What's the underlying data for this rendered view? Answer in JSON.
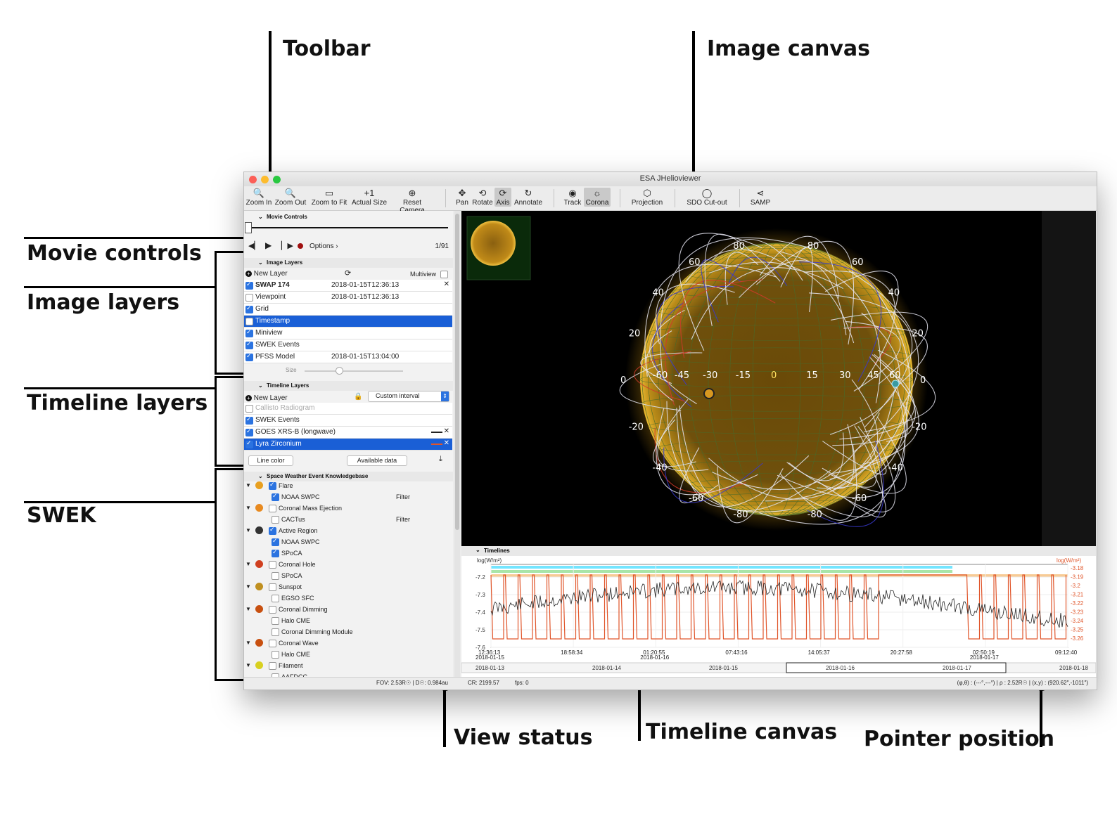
{
  "callouts": {
    "toolbar": "Toolbar",
    "image_canvas": "Image  canvas",
    "movie_controls": "Movie controls",
    "image_layers": "Image layers",
    "timeline_layers": "Timeline layers",
    "swek": "SWEK",
    "view_status": "View status",
    "timeline_canvas": "Timeline canvas",
    "pointer_position": "Pointer position"
  },
  "window": {
    "title": "ESA JHelioviewer"
  },
  "toolbar": {
    "buttons": [
      {
        "label": "Zoom In",
        "icon": "zoom-in-icon",
        "glyph": "🔍"
      },
      {
        "label": "Zoom Out",
        "icon": "zoom-out-icon",
        "glyph": "🔍"
      },
      {
        "label": "Zoom to Fit",
        "icon": "zoom-fit-icon",
        "glyph": "▭"
      },
      {
        "label": "Actual Size",
        "icon": "actual-size-icon",
        "glyph": "+1"
      },
      {
        "label": "Reset Camera",
        "icon": "reset-camera-icon",
        "glyph": "⊕"
      },
      {
        "label": "Pan",
        "icon": "pan-icon",
        "glyph": "✥"
      },
      {
        "label": "Rotate",
        "icon": "rotate-icon",
        "glyph": "⟲"
      },
      {
        "label": "Axis",
        "icon": "axis-icon",
        "glyph": "⟳"
      },
      {
        "label": "Annotate",
        "icon": "annotate-icon",
        "glyph": "↻"
      },
      {
        "label": "Track",
        "icon": "track-icon",
        "glyph": "◉"
      },
      {
        "label": "Corona",
        "icon": "corona-icon",
        "glyph": "☼"
      },
      {
        "label": "Projection",
        "icon": "projection-icon",
        "glyph": "⬡"
      },
      {
        "label": "SDO Cut-out",
        "icon": "sdo-cutout-icon",
        "glyph": "◯"
      },
      {
        "label": "SAMP",
        "icon": "share-icon",
        "glyph": "⋖"
      }
    ]
  },
  "movie_controls": {
    "header": "Movie Controls",
    "options_label": "Options ›",
    "frame": "1/91"
  },
  "image_layers": {
    "header": "Image Layers",
    "new_layer": "New Layer",
    "multiview": "Multiview",
    "layers": [
      {
        "name": "SWAP 174",
        "time": "2018-01-15T12:36:13",
        "checked": true,
        "selected": false,
        "bold": true
      },
      {
        "name": "Viewpoint",
        "time": "2018-01-15T12:36:13",
        "checked": false,
        "selected": false,
        "bold": false
      },
      {
        "name": "Grid",
        "time": "",
        "checked": true,
        "selected": false,
        "bold": false
      },
      {
        "name": "Timestamp",
        "time": "",
        "checked": false,
        "selected": true,
        "bold": false
      },
      {
        "name": "Miniview",
        "time": "",
        "checked": true,
        "selected": false,
        "bold": false
      },
      {
        "name": "SWEK Events",
        "time": "",
        "checked": true,
        "selected": false,
        "bold": false
      },
      {
        "name": "PFSS Model",
        "time": "2018-01-15T13:04:00",
        "checked": true,
        "selected": false,
        "bold": false
      }
    ],
    "size_label": "Size"
  },
  "timeline_layers": {
    "header": "Timeline Layers",
    "new_layer": "New Layer",
    "interval": "Custom interval",
    "layers": [
      {
        "name": "Callisto Radiogram",
        "checked": false,
        "selected": false,
        "disabled": true
      },
      {
        "name": "SWEK Events",
        "checked": true,
        "selected": false,
        "disabled": false
      },
      {
        "name": "GOES XRS-B (longwave)",
        "checked": true,
        "selected": false,
        "disabled": false
      },
      {
        "name": "Lyra Zirconium",
        "checked": true,
        "selected": true,
        "disabled": false
      }
    ],
    "line_color": "Line color",
    "available_data": "Available data"
  },
  "swek": {
    "header": "Space Weather Event Knowledgebase",
    "filter": "Filter",
    "items": [
      {
        "label": "Flare",
        "level": 0,
        "checked": true,
        "color": "#e8a020"
      },
      {
        "label": "NOAA SWPC",
        "level": 1,
        "checked": true,
        "filter": true
      },
      {
        "label": "Coronal Mass Ejection",
        "level": 0,
        "checked": false,
        "color": "#e88a20"
      },
      {
        "label": "CACTus",
        "level": 1,
        "checked": false,
        "filter": true
      },
      {
        "label": "Active Region",
        "level": 0,
        "checked": true,
        "color": "#333333"
      },
      {
        "label": "NOAA SWPC",
        "level": 1,
        "checked": true
      },
      {
        "label": "SPoCA",
        "level": 1,
        "checked": true
      },
      {
        "label": "Coronal Hole",
        "level": 0,
        "checked": false,
        "color": "#d04020"
      },
      {
        "label": "SPoCA",
        "level": 1,
        "checked": false
      },
      {
        "label": "Sunspot",
        "level": 0,
        "checked": false,
        "color": "#c09020"
      },
      {
        "label": "EGSO SFC",
        "level": 1,
        "checked": false
      },
      {
        "label": "Coronal Dimming",
        "level": 0,
        "checked": false,
        "color": "#c85010"
      },
      {
        "label": "Halo CME",
        "level": 1,
        "checked": false
      },
      {
        "label": "Coronal Dimming Module",
        "level": 1,
        "checked": false
      },
      {
        "label": "Coronal Wave",
        "level": 0,
        "checked": false,
        "color": "#c85010"
      },
      {
        "label": "Halo CME",
        "level": 1,
        "checked": false
      },
      {
        "label": "Filament",
        "level": 0,
        "checked": false,
        "color": "#d8d020"
      },
      {
        "label": "AAFDCC",
        "level": 1,
        "checked": false
      }
    ]
  },
  "image_canvas": {
    "grid_lon_labels": [
      "-60",
      "-45",
      "-30",
      "-15",
      "0",
      "15",
      "30",
      "45",
      "60"
    ],
    "grid_lat_labels": [
      "80",
      "60",
      "40",
      "20",
      "0",
      "-20",
      "-40",
      "-60",
      "-80"
    ]
  },
  "timelines": {
    "header": "Timelines",
    "left_unit": "log(W/m²)",
    "right_unit": "log(W/m²)",
    "left_ticks": [
      "-7.2",
      "-7.3",
      "-7.4",
      "-7.5",
      "-7.6"
    ],
    "right_ticks": [
      "-3.18",
      "-3.19",
      "-3.2",
      "-3.21",
      "-3.22",
      "-3.23",
      "-3.24",
      "-3.25",
      "-3.26"
    ],
    "x_ticks": [
      {
        "time": "12:36:13",
        "date": "2018-01-15"
      },
      {
        "time": "18:58:34",
        "date": ""
      },
      {
        "time": "01:20:55",
        "date": "2018-01-16"
      },
      {
        "time": "07:43:16",
        "date": ""
      },
      {
        "time": "14:05:37",
        "date": ""
      },
      {
        "time": "20:27:58",
        "date": ""
      },
      {
        "time": "02:50:19",
        "date": "2018-01-17"
      },
      {
        "time": "09:12:40",
        "date": ""
      }
    ],
    "overview_dates": [
      "2018-01-13",
      "2018-01-14",
      "2018-01-15",
      "2018-01-16",
      "2018-01-17",
      "2018-01-18"
    ],
    "colors": {
      "goes": "#222222",
      "lyra": "#e0552a",
      "band1": "#00d0ff",
      "band2": "#60d060",
      "band3": "#f0a040"
    }
  },
  "status": {
    "fov": "FOV: 2.53R☉ | D☉: 0.984au",
    "cr": "CR: 2199.57",
    "fps": "fps: 0",
    "pointer": "(φ,θ) : (---°,---°) | ρ : 2.52R☉ | (x,y) : (920.62″,-1011″)"
  }
}
